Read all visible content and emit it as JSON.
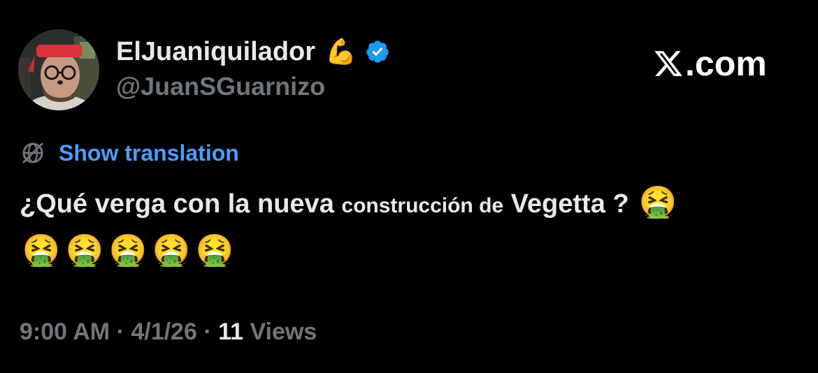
{
  "author": {
    "display_name": "ElJuaniquilador",
    "name_emoji": "💪",
    "verified_icon": "verified-badge-icon",
    "handle": "@JuanSGuarnizo"
  },
  "brand": {
    "logo_icon": "x-logo-icon",
    "domain_label": ".com"
  },
  "translation": {
    "icon": "globe-icon",
    "label": "Show translation"
  },
  "tweet": {
    "text_part1": "¿Qué verga con la nueva ",
    "text_small1": "construcción de",
    "text_part2": " Vegetta ",
    "text_part3": " ? ",
    "emojis": [
      "🤮",
      "🤮",
      "🤮",
      "🤮",
      "🤮",
      "🤮"
    ]
  },
  "meta": {
    "time": "9:00 AM",
    "separator": " · ",
    "date": "4/1/26",
    "views_count": "11",
    "views_label": " Views"
  },
  "colors": {
    "background": "#000000",
    "primary_text": "#e7e9ea",
    "secondary_text": "#71767b",
    "link": "#4a9eff",
    "verified": "#1d9bf0"
  }
}
